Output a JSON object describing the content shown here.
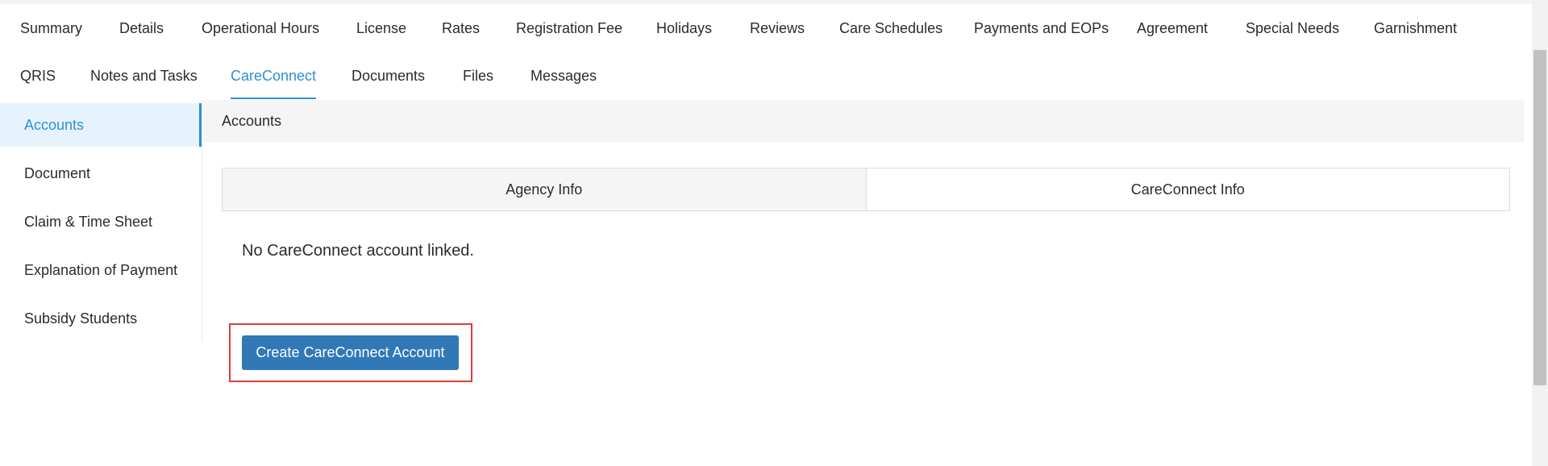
{
  "top_tabs_row1": [
    {
      "label": "Summary"
    },
    {
      "label": "Details"
    },
    {
      "label": "Operational Hours"
    },
    {
      "label": "License"
    },
    {
      "label": "Rates"
    },
    {
      "label": "Registration Fee"
    },
    {
      "label": "Holidays"
    },
    {
      "label": "Reviews"
    },
    {
      "label": "Care Schedules"
    },
    {
      "label": "Payments and EOPs"
    },
    {
      "label": "Agreement"
    },
    {
      "label": "Special Needs"
    },
    {
      "label": "Garnishment"
    }
  ],
  "top_tabs_row2": [
    {
      "label": "QRIS"
    },
    {
      "label": "Notes and Tasks"
    },
    {
      "label": "CareConnect",
      "active": true
    },
    {
      "label": "Documents"
    },
    {
      "label": "Files"
    },
    {
      "label": "Messages"
    }
  ],
  "sidebar": {
    "items": [
      {
        "label": "Accounts",
        "active": true
      },
      {
        "label": "Document"
      },
      {
        "label": "Claim & Time Sheet"
      },
      {
        "label": "Explanation of Payment"
      },
      {
        "label": "Subsidy Students"
      }
    ]
  },
  "panel": {
    "title": "Accounts",
    "sub_tabs": [
      {
        "label": "Agency Info"
      },
      {
        "label": "CareConnect Info"
      }
    ],
    "empty_message": "No CareConnect account linked.",
    "create_button_label": "Create CareConnect Account"
  },
  "colors": {
    "accent": "#2d8fd9",
    "button": "#3178b7",
    "highlight": "#e03b3b"
  }
}
